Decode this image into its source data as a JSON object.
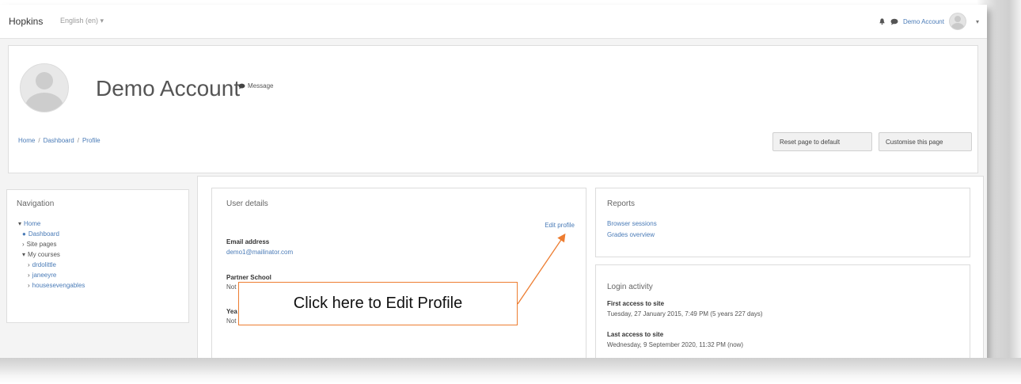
{
  "navbar": {
    "brand": "Hopkins",
    "language": "English (en) ▾",
    "bell_icon": "bell-icon",
    "chat_icon": "message-icon",
    "user_name": "Demo Account",
    "caret": "▾"
  },
  "header": {
    "title": "Demo Account",
    "message_label": "Message",
    "breadcrumb": [
      "Home",
      "Dashboard",
      "Profile"
    ],
    "reset_button": "Reset page to default",
    "customise_button": "Customise this page"
  },
  "navigation": {
    "title": "Navigation",
    "items": [
      {
        "prefix": "▾",
        "label": "Home",
        "link": true
      },
      {
        "prefix": "●",
        "label": "Dashboard",
        "link": true
      },
      {
        "prefix": "›",
        "label": "Site pages",
        "link": false
      },
      {
        "prefix": "▾",
        "label": "My courses",
        "link": false
      },
      {
        "prefix": "›",
        "label": "drdolittle",
        "link": true
      },
      {
        "prefix": "›",
        "label": "janeeyre",
        "link": true
      },
      {
        "prefix": "›",
        "label": "houseseven­gables",
        "link": true
      }
    ]
  },
  "user_details": {
    "title": "User details",
    "edit_profile": "Edit profile",
    "email_label": "Email address",
    "email_value": "demo1@mailinator.com",
    "school_label": "Partner School",
    "school_value": "Not",
    "year_label": "Yea",
    "year_value": "Not"
  },
  "reports": {
    "title": "Reports",
    "links": [
      "Browser sessions",
      "Grades overview"
    ]
  },
  "login_activity": {
    "title": "Login activity",
    "first_label": "First access to site",
    "first_value": "Tuesday, 27 January 2015, 7:49 PM  (5 years 227 days)",
    "last_label": "Last access to site",
    "last_value": "Wednesday, 9 September 2020, 11:32 PM  (now)"
  },
  "callout": {
    "text": "Click here to Edit Profile",
    "border_color": "#ed7d31"
  },
  "colors": {
    "link": "#4a7bb7",
    "accent": "#ed7d31"
  }
}
